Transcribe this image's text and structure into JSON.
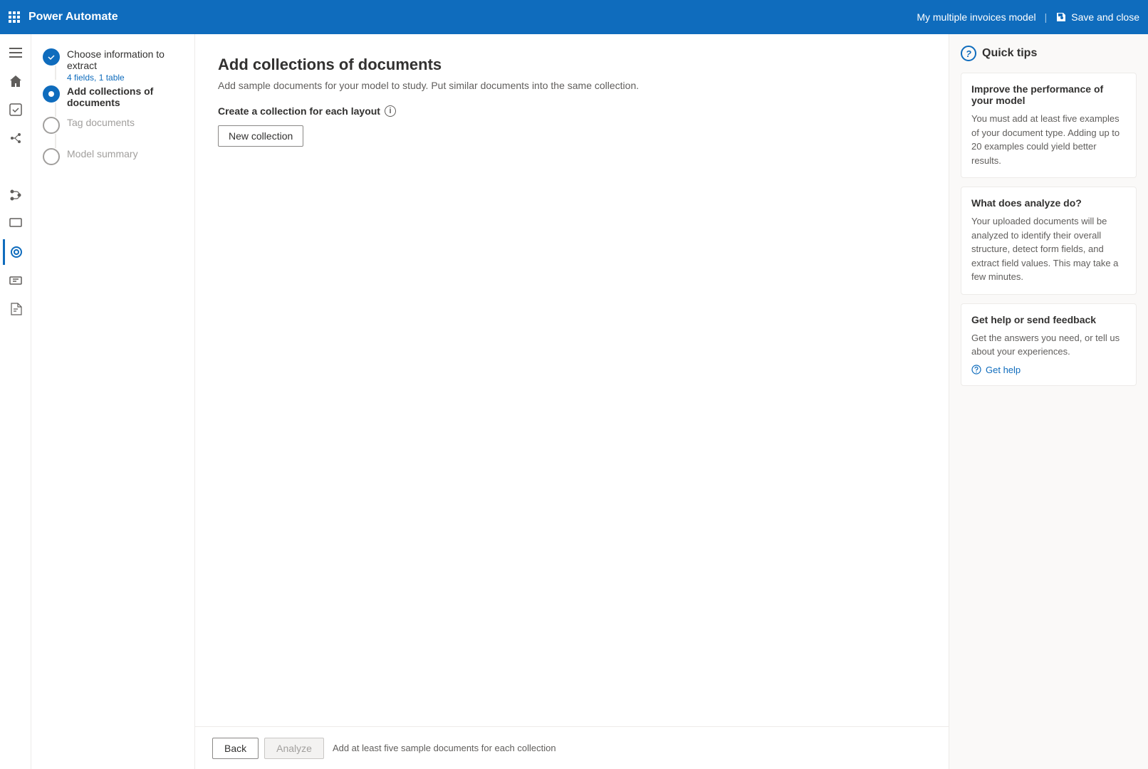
{
  "topbar": {
    "app_name": "Power Automate",
    "model_name": "My multiple invoices model",
    "save_close_label": "Save and close"
  },
  "wizard": {
    "steps": [
      {
        "id": "step-extract",
        "title": "Choose information to extract",
        "subtitle": "4 fields, 1 table",
        "state": "completed"
      },
      {
        "id": "step-collections",
        "title": "Add collections of documents",
        "subtitle": "",
        "state": "active"
      },
      {
        "id": "step-tag",
        "title": "Tag documents",
        "subtitle": "",
        "state": "inactive"
      },
      {
        "id": "step-summary",
        "title": "Model summary",
        "subtitle": "",
        "state": "inactive"
      }
    ]
  },
  "page": {
    "title": "Add collections of documents",
    "subtitle": "Add sample documents for your model to study. Put similar documents into the same collection.",
    "collection_layout_label": "Create a collection for each layout",
    "new_collection_button": "New collection"
  },
  "footer": {
    "back_label": "Back",
    "analyze_label": "Analyze",
    "hint": "Add at least five sample documents for each collection"
  },
  "quick_tips": {
    "title": "Quick tips",
    "cards": [
      {
        "title": "Improve the performance of your model",
        "text": "You must add at least five examples of your document type. Adding up to 20 examples could yield better results."
      },
      {
        "title": "What does analyze do?",
        "text": "Your uploaded documents will be analyzed to identify their overall structure, detect form fields, and extract field values. This may take a few minutes."
      },
      {
        "title": "Get help or send feedback",
        "text": "Get the answers you need, or tell us about your experiences.",
        "link": "Get help"
      }
    ]
  },
  "nav_icons": [
    {
      "name": "menu-icon",
      "symbol": "☰"
    },
    {
      "name": "home-icon",
      "symbol": "⌂"
    },
    {
      "name": "approvals-icon",
      "symbol": "✓"
    },
    {
      "name": "ai-icon",
      "symbol": "⚡"
    },
    {
      "name": "add-icon",
      "symbol": "+"
    },
    {
      "name": "share-icon",
      "symbol": "↗"
    },
    {
      "name": "monitor-icon",
      "symbol": "▦"
    },
    {
      "name": "data-icon",
      "symbol": "⊞"
    },
    {
      "name": "docs-icon",
      "symbol": "📄"
    },
    {
      "name": "book-icon",
      "symbol": "📖"
    }
  ]
}
